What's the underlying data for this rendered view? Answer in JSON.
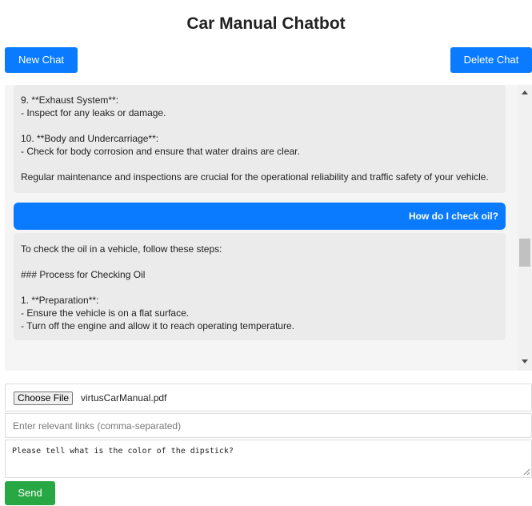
{
  "header": {
    "title": "Car Manual Chatbot"
  },
  "toolbar": {
    "new_chat_label": "New Chat",
    "delete_chat_label": "Delete Chat"
  },
  "chat": {
    "messages": [
      {
        "role": "bot",
        "lines": [
          "9. **Exhaust System**:",
          "- Inspect for any leaks or damage.",
          "",
          "10. **Body and Undercarriage**:",
          "- Check for body corrosion and ensure that water drains are clear.",
          "",
          "Regular maintenance and inspections are crucial for the operational reliability and traffic safety of your vehicle."
        ]
      },
      {
        "role": "user",
        "text": "How do I check oil?"
      },
      {
        "role": "bot",
        "lines": [
          "To check the oil in a vehicle, follow these steps:",
          "",
          "### Process for Checking Oil",
          "",
          "1. **Preparation**:",
          "- Ensure the vehicle is on a flat surface.",
          "- Turn off the engine and allow it to reach operating temperature."
        ]
      }
    ]
  },
  "upload": {
    "button_label": "Choose File",
    "file_name": "virtusCarManual.pdf"
  },
  "links_input": {
    "placeholder": "Enter relevant links (comma-separated)",
    "value": ""
  },
  "message_input": {
    "value": "Please tell what is the color of the dipstick?"
  },
  "send": {
    "label": "Send"
  },
  "colors": {
    "primary": "#0a7bff",
    "send": "#28a745",
    "bot_bubble": "#ebebeb",
    "chat_bg": "#f5f5f5"
  }
}
